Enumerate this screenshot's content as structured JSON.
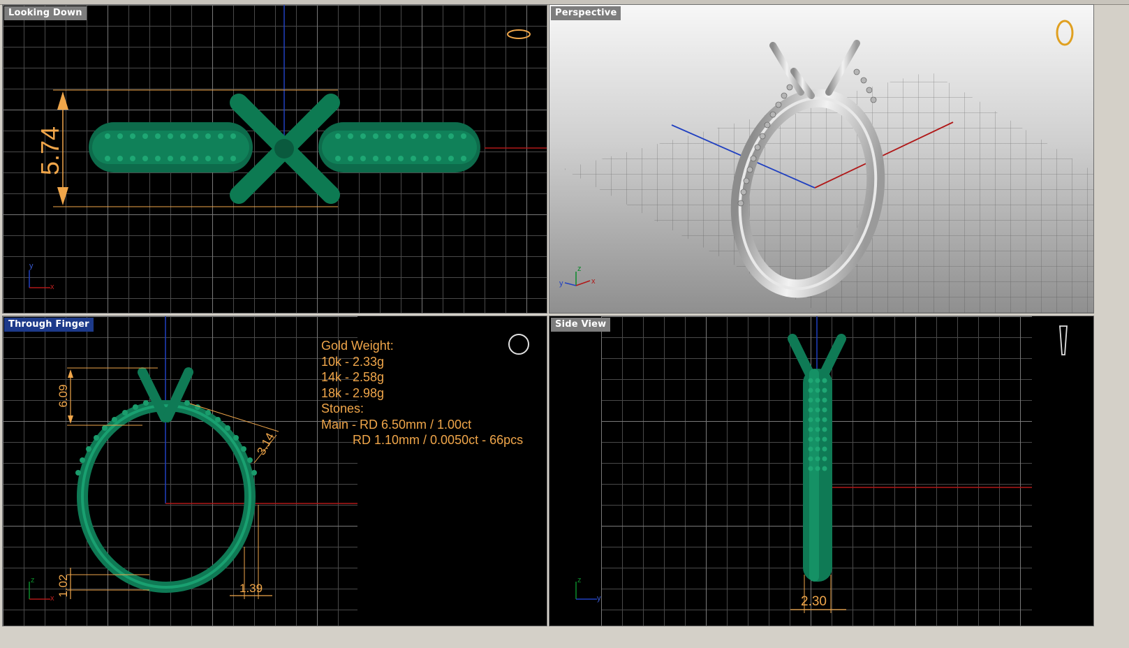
{
  "viewports": {
    "top": {
      "label": "Looking Down",
      "dimension": "5.74",
      "axis_y": "y",
      "axis_x": "x"
    },
    "perspective": {
      "label": "Perspective",
      "axis_z": "z",
      "axis_x": "x",
      "axis_y": "y"
    },
    "front": {
      "label": "Through Finger",
      "dims": {
        "height": "6.09",
        "band_top": "3.14",
        "shank": "1.02",
        "band_bottom": "1.39"
      },
      "axis_z": "z",
      "axis_x": "x"
    },
    "side": {
      "label": "Side View",
      "dimension": "2.30",
      "axis_z": "z",
      "axis_y": "y"
    }
  },
  "specs": {
    "title": "Gold Weight:",
    "lines": [
      "10k - 2.33g",
      "14k - 2.58g",
      "18k - 2.98g"
    ],
    "stones_label": "Stones:",
    "stone_lines": [
      "Main - RD 6.50mm / 1.00ct",
      "         RD 1.10mm / 0.0050ct - 66pcs"
    ]
  },
  "colors": {
    "model_green": "#0f7a55",
    "dimension_orange": "#f0a64a",
    "axis_red": "#b01818",
    "axis_blue": "#2040c0",
    "metal_silver": "#c9c9c9"
  }
}
